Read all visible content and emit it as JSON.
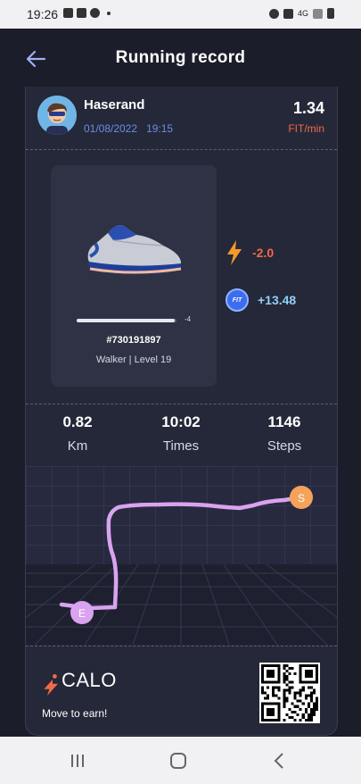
{
  "status_bar": {
    "time": "19:26",
    "network": "4G"
  },
  "header": {
    "title": "Running record",
    "back_icon": "arrow-left-icon"
  },
  "record": {
    "username": "Haserand",
    "date": "01/08/2022",
    "time": "19:15",
    "rate": "1.34",
    "rate_unit": "FIT/min"
  },
  "shoe": {
    "id": "#730191897",
    "type_level": "Walker | Level 19",
    "durability_change": "-4",
    "durability_fraction": 0.98
  },
  "energy": {
    "icon": "lightning-bolt-icon",
    "value": "-2.0"
  },
  "fit": {
    "coin_label": "FIT",
    "value": "+13.48"
  },
  "stats": [
    {
      "value": "0.82",
      "label": "Km"
    },
    {
      "value": "10:02",
      "label": "Times"
    },
    {
      "value": "1146",
      "label": "Steps"
    }
  ],
  "map": {
    "start_label": "S",
    "end_label": "E"
  },
  "brand": {
    "name": "CALO",
    "slogan": "Move to earn!"
  },
  "colors": {
    "accent_orange": "#f06a4a",
    "route": "#d9a3f0",
    "start": "#f5a25a",
    "end": "#d9a3f0"
  }
}
